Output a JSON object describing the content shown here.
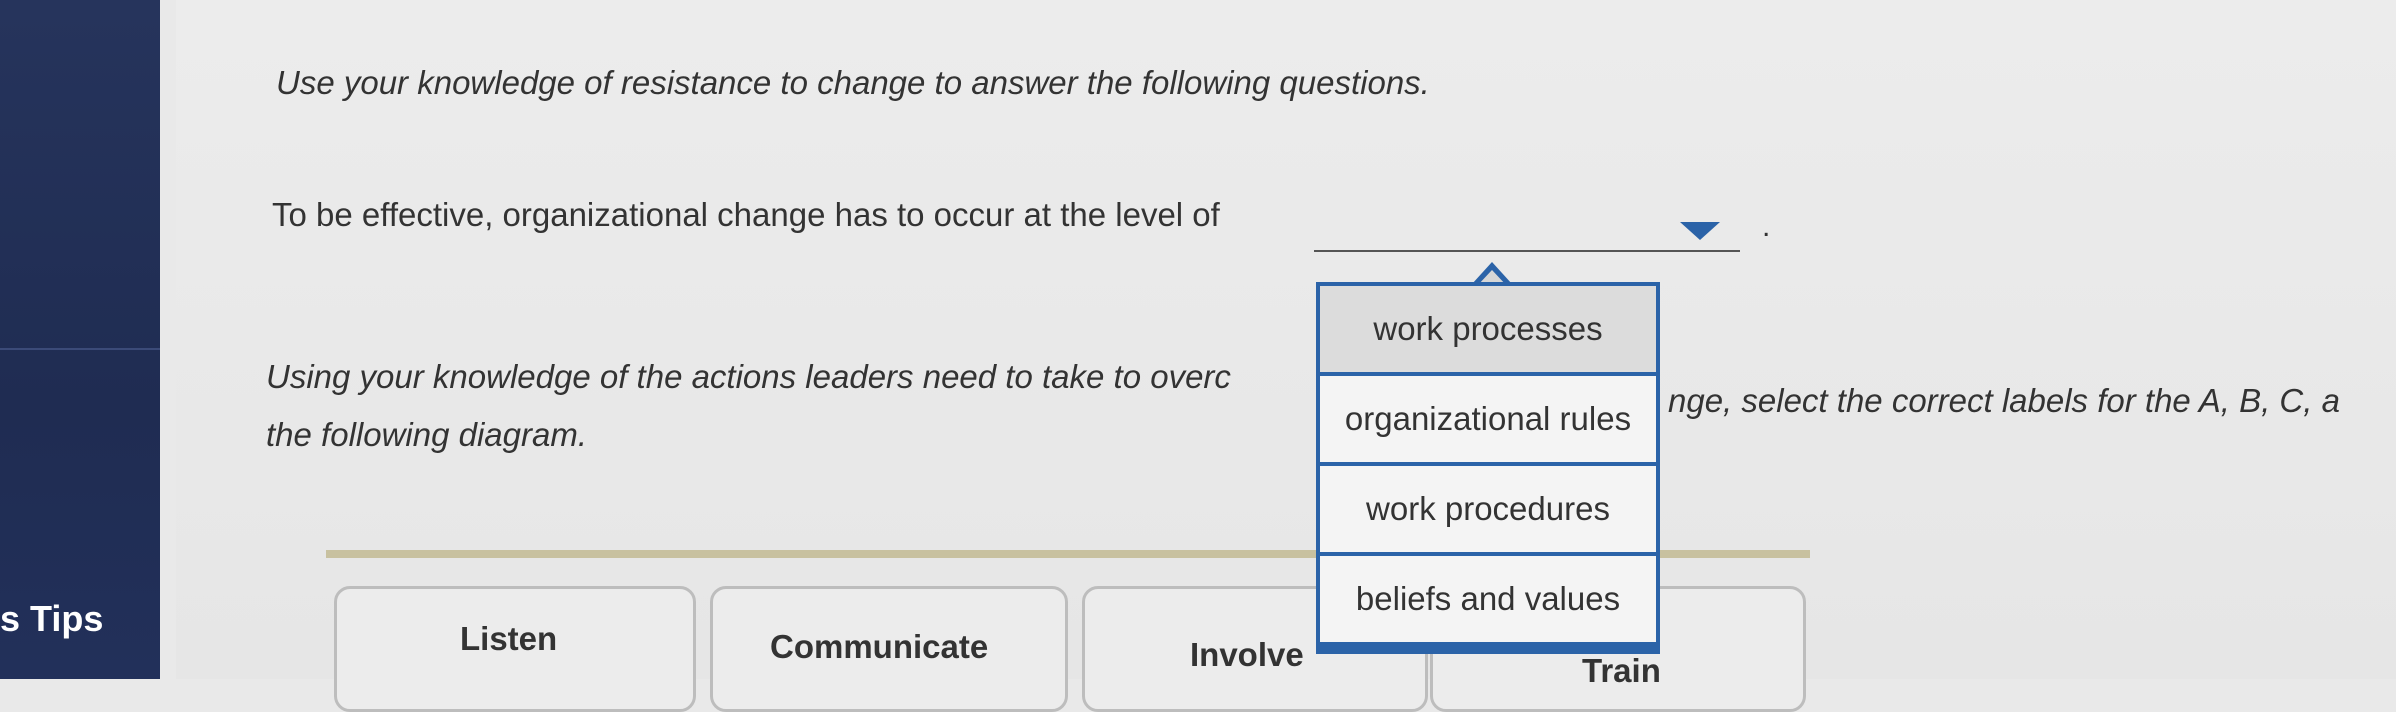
{
  "sidebar": {
    "tips_label": "s Tips"
  },
  "question": {
    "intro": "Use your knowledge of resistance to change to answer the following questions.",
    "q1_text": "To be effective, organizational change has to occur at the level of",
    "q1_period": ".",
    "q2_part1": "Using your knowledge of the actions leaders need to take to overc",
    "q2_part2": "nge, select the correct labels for the A, B, C, a",
    "q2_line2": "the following diagram."
  },
  "dropdown": {
    "options": [
      "work processes",
      "organizational rules",
      "work procedures",
      "beliefs and values"
    ]
  },
  "labels": [
    "Listen",
    "Communicate",
    "Involve",
    "Train"
  ],
  "colors": {
    "accent": "#2b63a8",
    "sidebar": "#22305a"
  }
}
